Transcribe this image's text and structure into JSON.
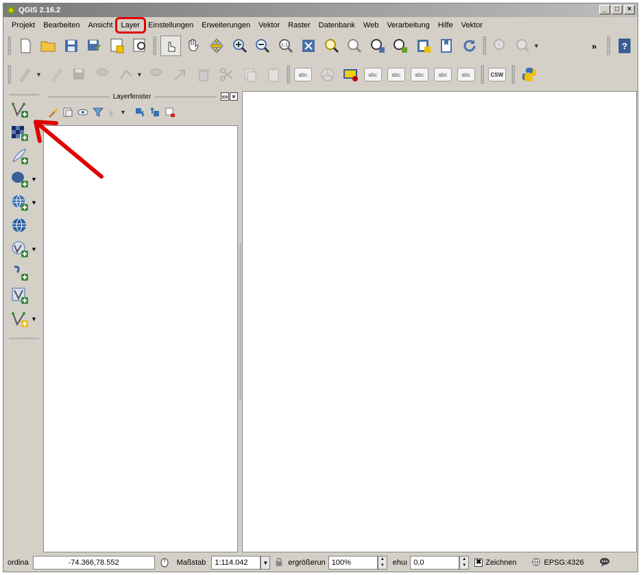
{
  "window": {
    "title": "QGIS 2.16.2",
    "controls": [
      "_",
      "□",
      "×"
    ]
  },
  "menubar": {
    "items": [
      "Projekt",
      "Bearbeiten",
      "Ansicht",
      "Layer",
      "Einstellungen",
      "Erweiterungen",
      "Vektor",
      "Raster",
      "Datenbank",
      "Web",
      "Verarbeitung",
      "Hilfe",
      "Vektor"
    ]
  },
  "toolbar2": {
    "csw_label": "CSW",
    "label_buttons": [
      "abc",
      "abc",
      "abc",
      "abc",
      "abc",
      "abc",
      "abc"
    ]
  },
  "layer_panel": {
    "title": "Layerfenster",
    "float_btn": "▭",
    "close_btn": "×"
  },
  "toolbar1": {
    "overflow": "»",
    "help": "?"
  },
  "statusbar": {
    "coord_label": "ordina",
    "coord_value": "-74.366,78.552",
    "scale_label": "Maßstab",
    "scale_value": "1:114.042",
    "magnifier_label": "ergrößerun",
    "magnifier_value": "100%",
    "rotation_label": "ehuı",
    "rotation_value": "0,0",
    "render_label": "Zeichnen",
    "render_checked": "✖",
    "crs_label": "EPSG:4326"
  },
  "colors": {
    "annotation_red": "#e00000",
    "panel_bg": "#d4d0c8"
  }
}
